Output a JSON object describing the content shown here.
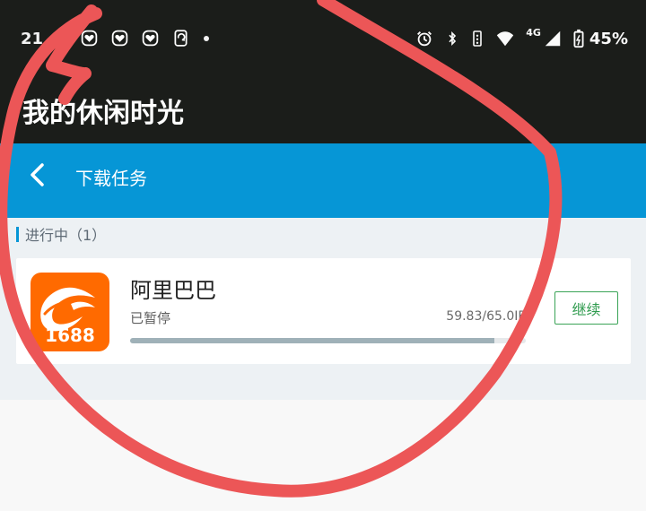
{
  "status_bar": {
    "time": "21",
    "network": "4G",
    "battery": "45%",
    "left_icons": [
      "sticker-icon",
      "sticker-icon",
      "sticker-icon",
      "phone-rotate-icon",
      "dot-icon"
    ],
    "right_icons": [
      "alarm-icon",
      "bluetooth-icon",
      "vibrate-icon",
      "wifi-icon",
      "signal-icon",
      "battery-icon"
    ]
  },
  "app": {
    "name": "我的休闲时光"
  },
  "header": {
    "title": "下载任务"
  },
  "section": {
    "label": "进行中（1）"
  },
  "download_item": {
    "app_name": "阿里巴巴",
    "icon_text": "1688",
    "status": "已暂停",
    "size": "59.83/65.0",
    "size_unit": "IB",
    "progress": 0.92,
    "button_label": "继续"
  },
  "colors": {
    "top_bar": "#1b1d1a",
    "header": "#0696d6",
    "accent": "#0696d6",
    "button_green": "#3aa356",
    "app_orange": "#ff6a00",
    "annotation_red": "#ec5657"
  }
}
